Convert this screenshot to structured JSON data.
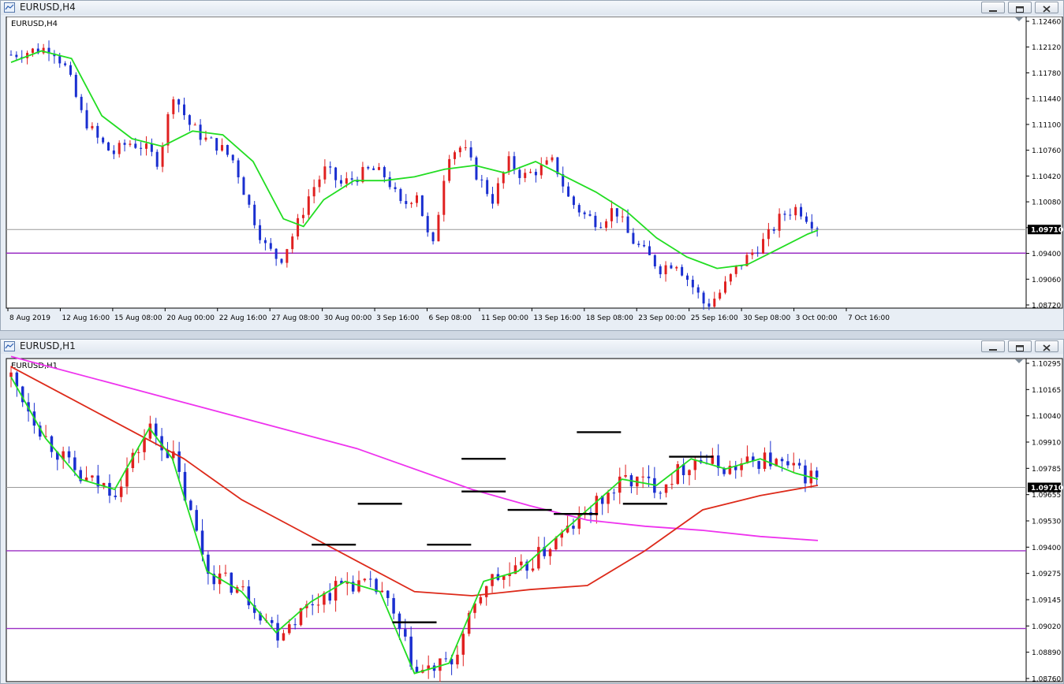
{
  "windows": [
    {
      "title": "EURUSD,H4",
      "chart_label": "EURUSD,H4",
      "current_price": "1.09710",
      "price_ticks": [
        "1.12460",
        "1.12120",
        "1.11780",
        "1.11440",
        "1.11100",
        "1.10760",
        "1.10420",
        "1.10080",
        "1.09740",
        "1.09400",
        "1.09060",
        "1.08720"
      ],
      "time_ticks": [
        "8 Aug 2019",
        "12 Aug 16:00",
        "15 Aug 08:00",
        "20 Aug 00:00",
        "22 Aug 16:00",
        "27 Aug 08:00",
        "30 Aug 00:00",
        "3 Sep 16:00",
        "6 Sep 08:00",
        "11 Sep 00:00",
        "13 Sep 16:00",
        "18 Sep 08:00",
        "23 Sep 00:00",
        "25 Sep 16:00",
        "30 Sep 08:00",
        "3 Oct 00:00",
        "7 Oct 16:00"
      ]
    },
    {
      "title": "EURUSD,H1",
      "chart_label": "EURUSD,H1",
      "current_price": "1.09710",
      "price_ticks": [
        "1.10295",
        "1.10165",
        "1.10040",
        "1.09910",
        "1.09785",
        "1.09655",
        "1.09530",
        "1.09400",
        "1.09275",
        "1.09145",
        "1.09020",
        "1.08890",
        "1.08760"
      ],
      "time_ticks": []
    }
  ],
  "chart_data": [
    {
      "type": "candlestick",
      "title": "EURUSD,H4",
      "ylim": [
        1.0868,
        1.125
      ],
      "x_ticks": [
        "8 Aug 2019",
        "12 Aug 16:00",
        "15 Aug 08:00",
        "20 Aug 00:00",
        "22 Aug 16:00",
        "27 Aug 08:00",
        "30 Aug 00:00",
        "3 Sep 16:00",
        "6 Sep 08:00",
        "11 Sep 00:00",
        "13 Sep 16:00",
        "18 Sep 08:00",
        "23 Sep 00:00",
        "25 Sep 16:00",
        "30 Sep 08:00",
        "3 Oct 00:00",
        "7 Oct 16:00"
      ],
      "close_path": [
        [
          0,
          1.12
        ],
        [
          4,
          1.1205
        ],
        [
          8,
          1.121
        ],
        [
          11,
          1.118
        ],
        [
          14,
          1.112
        ],
        [
          17,
          1.109
        ],
        [
          20,
          1.107
        ],
        [
          23,
          1.1085
        ],
        [
          26,
          1.108
        ],
        [
          29,
          1.106
        ],
        [
          32,
          1.115
        ],
        [
          35,
          1.111
        ],
        [
          38,
          1.109
        ],
        [
          41,
          1.108
        ],
        [
          44,
          1.106
        ],
        [
          47,
          1.1
        ],
        [
          50,
          1.095
        ],
        [
          53,
          1.093
        ],
        [
          56,
          1.097
        ],
        [
          59,
          1.102
        ],
        [
          62,
          1.105
        ],
        [
          65,
          1.103
        ],
        [
          68,
          1.104
        ],
        [
          71,
          1.105
        ],
        [
          74,
          1.104
        ],
        [
          77,
          1.1
        ],
        [
          80,
          1.102
        ],
        [
          83,
          1.094
        ],
        [
          86,
          1.107
        ],
        [
          89,
          1.108
        ],
        [
          92,
          1.104
        ],
        [
          95,
          1.101
        ],
        [
          98,
          1.106
        ],
        [
          101,
          1.104
        ],
        [
          104,
          1.105
        ],
        [
          107,
          1.106
        ],
        [
          110,
          1.101
        ],
        [
          113,
          1.099
        ],
        [
          116,
          1.098
        ],
        [
          119,
          1.1
        ],
        [
          122,
          1.096
        ],
        [
          125,
          1.094
        ],
        [
          128,
          1.092
        ],
        [
          131,
          1.093
        ],
        [
          134,
          1.09
        ],
        [
          137,
          1.087
        ],
        [
          140,
          1.089
        ],
        [
          143,
          1.092
        ],
        [
          146,
          1.094
        ],
        [
          149,
          1.096
        ],
        [
          152,
          1.099
        ],
        [
          155,
          1.1
        ],
        [
          158,
          1.098
        ],
        [
          160,
          1.0971
        ]
      ],
      "sma_green": [
        [
          0,
          1.119
        ],
        [
          6,
          1.1205
        ],
        [
          12,
          1.1195
        ],
        [
          18,
          1.112
        ],
        [
          24,
          1.109
        ],
        [
          30,
          1.108
        ],
        [
          36,
          1.11
        ],
        [
          42,
          1.1095
        ],
        [
          48,
          1.106
        ],
        [
          54,
          1.0985
        ],
        [
          58,
          1.0975
        ],
        [
          62,
          1.101
        ],
        [
          68,
          1.1035
        ],
        [
          74,
          1.1035
        ],
        [
          80,
          1.104
        ],
        [
          86,
          1.105
        ],
        [
          92,
          1.1055
        ],
        [
          98,
          1.1045
        ],
        [
          104,
          1.106
        ],
        [
          110,
          1.104
        ],
        [
          116,
          1.102
        ],
        [
          122,
          1.0995
        ],
        [
          128,
          1.096
        ],
        [
          134,
          1.0935
        ],
        [
          140,
          1.092
        ],
        [
          146,
          1.0925
        ],
        [
          152,
          1.0945
        ],
        [
          158,
          1.0965
        ],
        [
          160,
          1.097
        ]
      ],
      "horizontal_lines": [
        1.0971,
        1.094
      ]
    },
    {
      "type": "candlestick",
      "title": "EURUSD,H1",
      "ylim": [
        1.0876,
        1.1034
      ],
      "x_ticks": [],
      "sma_green": [
        [
          0,
          1.1025
        ],
        [
          6,
          1.0995
        ],
        [
          12,
          1.0975
        ],
        [
          18,
          1.097
        ],
        [
          24,
          1.1
        ],
        [
          28,
          1.0985
        ],
        [
          34,
          1.093
        ],
        [
          40,
          1.092
        ],
        [
          46,
          1.09
        ],
        [
          52,
          1.0915
        ],
        [
          58,
          1.0925
        ],
        [
          64,
          1.092
        ],
        [
          70,
          1.088
        ],
        [
          76,
          1.0885
        ],
        [
          82,
          1.0925
        ],
        [
          88,
          1.093
        ],
        [
          94,
          1.0945
        ],
        [
          100,
          1.096
        ],
        [
          106,
          1.0975
        ],
        [
          112,
          1.0972
        ],
        [
          118,
          1.0985
        ],
        [
          124,
          1.098
        ],
        [
          130,
          1.0985
        ],
        [
          136,
          1.0978
        ],
        [
          140,
          1.0975
        ]
      ],
      "sma_red": [
        [
          0,
          1.103
        ],
        [
          10,
          1.1015
        ],
        [
          20,
          1.1
        ],
        [
          30,
          1.0985
        ],
        [
          40,
          1.0965
        ],
        [
          50,
          1.095
        ],
        [
          60,
          1.0935
        ],
        [
          70,
          1.092
        ],
        [
          80,
          1.0918
        ],
        [
          90,
          1.0921
        ],
        [
          100,
          1.0923
        ],
        [
          110,
          1.094
        ],
        [
          120,
          1.096
        ],
        [
          130,
          1.0967
        ],
        [
          140,
          1.0972
        ]
      ],
      "sma_magenta": [
        [
          0,
          1.1035
        ],
        [
          20,
          1.102
        ],
        [
          40,
          1.1005
        ],
        [
          60,
          1.099
        ],
        [
          80,
          1.097
        ],
        [
          90,
          1.0962
        ],
        [
          100,
          1.0955
        ],
        [
          110,
          1.0952
        ],
        [
          120,
          1.095
        ],
        [
          130,
          1.0947
        ],
        [
          140,
          1.0945
        ]
      ],
      "horizontal_lines": [
        1.0971,
        1.094,
        1.0902
      ],
      "level_markers": [
        [
          56,
          1.0943
        ],
        [
          64,
          1.0963
        ],
        [
          70,
          1.0905
        ],
        [
          76,
          1.0943
        ],
        [
          82,
          1.0969
        ],
        [
          82,
          1.0985
        ],
        [
          90,
          1.096
        ],
        [
          98,
          1.0958
        ],
        [
          102,
          1.0998
        ],
        [
          110,
          1.0963
        ],
        [
          118,
          1.0986
        ]
      ]
    }
  ],
  "colors": {
    "bull": "#e02020",
    "bear": "#1a2fd0",
    "sma_green": "#22dd22",
    "sma_red": "#dd2a1a",
    "sma_magenta": "#ee33ee",
    "hline_purple": "#9b2fc4",
    "price_line": "#9a9a9a"
  }
}
